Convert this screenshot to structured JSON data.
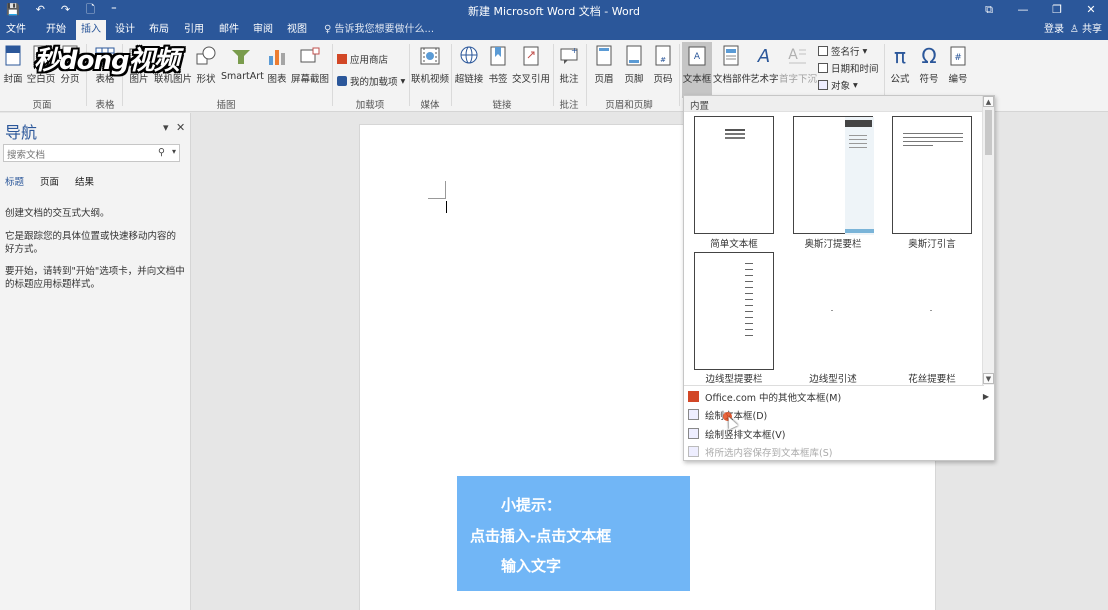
{
  "window": {
    "title": "新建 Microsoft Word 文档 - Word",
    "qat": [
      "💾",
      "↶",
      "↷",
      "🗋",
      "⁼"
    ],
    "controls": [
      "⧉",
      "—",
      "❐",
      "✕"
    ]
  },
  "tabs": [
    {
      "label": "文件",
      "active": false
    },
    {
      "label": "开始",
      "active": false
    },
    {
      "label": "插入",
      "active": true
    },
    {
      "label": "设计",
      "active": false
    },
    {
      "label": "布局",
      "active": false
    },
    {
      "label": "引用",
      "active": false
    },
    {
      "label": "邮件",
      "active": false
    },
    {
      "label": "审阅",
      "active": false
    },
    {
      "label": "视图",
      "active": false
    }
  ],
  "tellme": "♀ 告诉我您想要做什么...",
  "account": {
    "login": "登录",
    "share": "♙ 共享"
  },
  "watermark": "秒dong视频",
  "ribbon": {
    "buttons": {
      "cover": "封面",
      "blank": "空白页",
      "pagebreak": "分页",
      "table": "表格",
      "picture": "图片",
      "online_picture": "联机图片",
      "shapes": "形状",
      "smartart": "SmartArt",
      "chart": "图表",
      "screenshot": "屏幕截图",
      "store": "应用商店",
      "myaddins": "我的加载项",
      "online_video": "联机视频",
      "hyperlink": "超链接",
      "bookmark": "书签",
      "crossref": "交叉引用",
      "comment": "批注",
      "header": "页眉",
      "footer": "页脚",
      "pagenum": "页码",
      "textbox": "文本框",
      "quickparts": "文档部件",
      "wordart": "艺术字",
      "dropcap": "首字下沉",
      "signature": "签名行",
      "datetime": "日期和时间",
      "object": "对象",
      "equation": "公式",
      "symbol": "符号",
      "number": "编号"
    },
    "groups": {
      "pages": "页面",
      "tables": "表格",
      "illustrations": "插图",
      "addins": "加载项",
      "media": "媒体",
      "links": "链接",
      "comments": "批注",
      "headerfooter": "页眉和页脚"
    }
  },
  "nav": {
    "title": "导航",
    "search_placeholder": "搜索文档",
    "tabs": [
      "标题",
      "页面",
      "结果"
    ],
    "text1": "创建文档的交互式大纲。",
    "text2": "它是跟踪您的具体位置或快速移动内容的好方式。",
    "text3": "要开始，请转到\"开始\"选项卡，并向文档中的标题应用标题样式。"
  },
  "gallery": {
    "header": "内置",
    "items": [
      "简单文本框",
      "奥斯汀提要栏",
      "奥斯汀引言",
      "边线型提要栏",
      "边线型引述",
      "花丝提要栏"
    ],
    "menu": {
      "more": "Office.com 中的其他文本框(M)",
      "draw": "绘制文本框(D)",
      "draw_vertical": "绘制竖排文本框(V)",
      "save": "将所选内容保存到文本框库(S)"
    }
  },
  "tip": {
    "line1": "小提示：",
    "line2": "点击插入-点击文本框",
    "line3": "输入文字"
  },
  "colors": {
    "accent": "#2b579a",
    "tipbox": "#71b6f6",
    "click": "#e64b1c"
  }
}
